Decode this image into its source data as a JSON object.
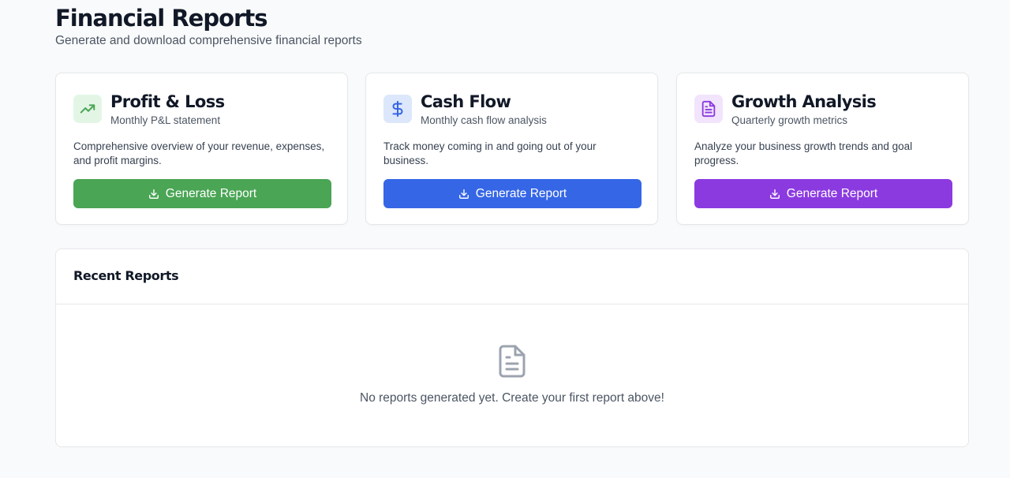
{
  "header": {
    "title": "Financial Reports",
    "subtitle": "Generate and download comprehensive financial reports"
  },
  "cards": [
    {
      "title": "Profit & Loss",
      "subtitle": "Monthly P&L statement",
      "description": "Comprehensive overview of your revenue, expenses, and profit margins.",
      "button_label": "Generate Report",
      "icon": "trending-up-icon",
      "accent": "#4aa555",
      "icon_bg": "#e3f6e6"
    },
    {
      "title": "Cash Flow",
      "subtitle": "Monthly cash flow analysis",
      "description": "Track money coming in and going out of your business.",
      "button_label": "Generate Report",
      "icon": "dollar-sign-icon",
      "accent": "#3566e6",
      "icon_bg": "#dde7fb"
    },
    {
      "title": "Growth Analysis",
      "subtitle": "Quarterly growth metrics",
      "description": "Analyze your business growth trends and goal progress.",
      "button_label": "Generate Report",
      "icon": "document-icon",
      "accent": "#8b3ae0",
      "icon_bg": "#f1e4fc"
    }
  ],
  "recent": {
    "title": "Recent Reports",
    "empty_message": "No reports generated yet. Create your first report above!",
    "empty_icon": "document-icon"
  }
}
